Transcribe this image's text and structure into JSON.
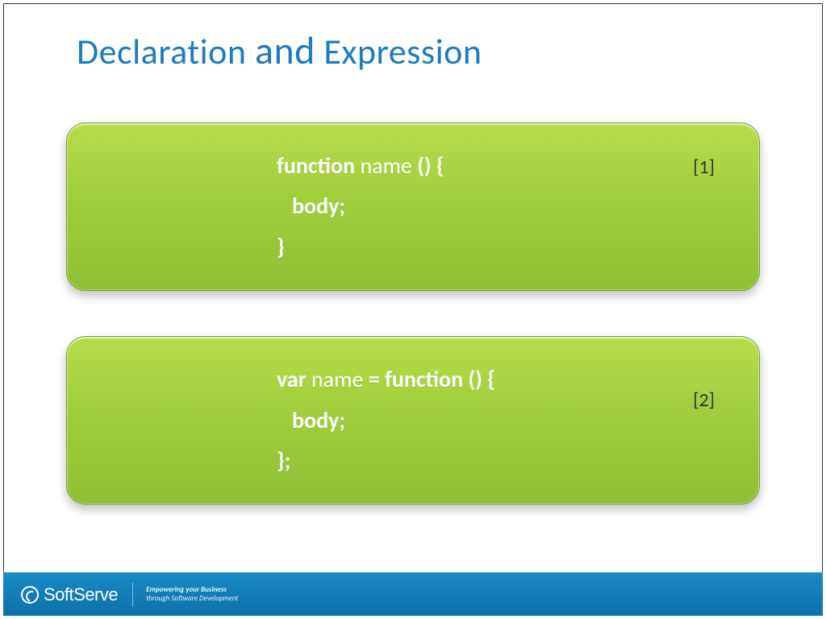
{
  "title": {
    "word1": "Declaration",
    "word2": "and",
    "word3": "Expression"
  },
  "cards": [
    {
      "tag": "[1]",
      "lines": [
        {
          "segments": [
            {
              "t": "function",
              "b": true
            },
            {
              "t": " name ",
              "b": false
            },
            {
              "t": "() {",
              "b": true
            }
          ]
        },
        {
          "segments": [
            {
              "t": "   body;",
              "b": true
            }
          ]
        },
        {
          "segments": [
            {
              "t": "}",
              "b": true
            }
          ]
        }
      ]
    },
    {
      "tag": "[2]",
      "lines": [
        {
          "segments": [
            {
              "t": "var",
              "b": true
            },
            {
              "t": " name ",
              "b": false
            },
            {
              "t": "= function () {",
              "b": true
            }
          ]
        },
        {
          "segments": [
            {
              "t": "   body;",
              "b": true
            }
          ]
        },
        {
          "segments": [
            {
              "t": "};",
              "b": true
            }
          ]
        }
      ]
    }
  ],
  "footer": {
    "brand_soft": "Soft",
    "brand_serve": "Serve",
    "tagline1": "Empowering your Business",
    "tagline2": "through Software Development"
  }
}
